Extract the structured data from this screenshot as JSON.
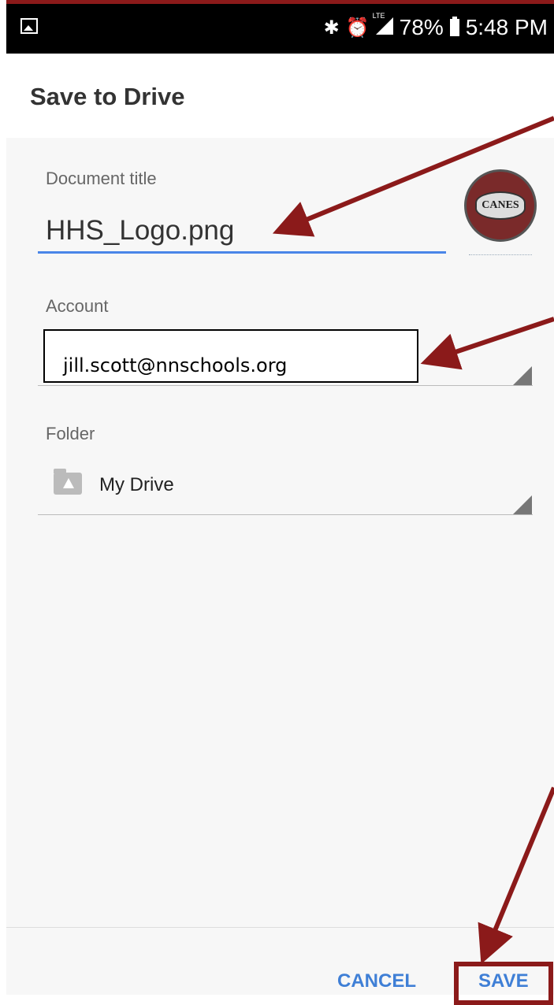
{
  "status_bar": {
    "battery": "78%",
    "time": "5:48 PM",
    "lte": "LTE",
    "icons": [
      "image-icon",
      "bluetooth-icon",
      "alarm-icon",
      "signal-icon",
      "battery-icon"
    ]
  },
  "dialog": {
    "title": "Save to Drive",
    "document_title_label": "Document title",
    "document_title_value": "HHS_Logo.png",
    "thumbnail_text": "CANES",
    "account_label": "Account",
    "account_value": "jill.scott@nnschools.org",
    "folder_label": "Folder",
    "folder_value": "My Drive"
  },
  "actions": {
    "cancel": "CANCEL",
    "save": "SAVE"
  },
  "colors": {
    "accent": "#4a86e8",
    "button": "#3f7fd6",
    "annotation": "#8b1a1a"
  }
}
